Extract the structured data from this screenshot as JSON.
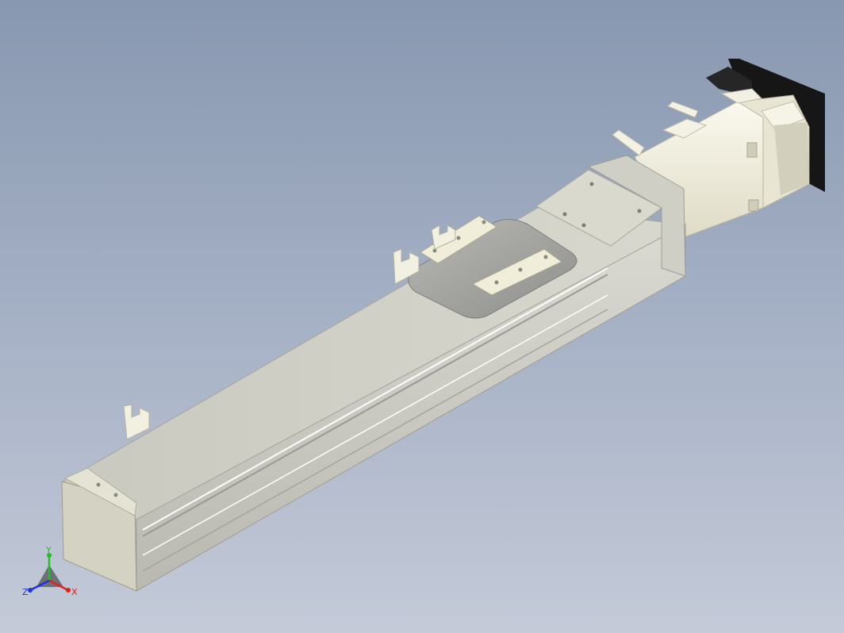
{
  "viewport": {
    "background_top": "#8898b0",
    "background_bottom": "#c4cad8"
  },
  "model": {
    "part": "linear-actuator-with-servo-motor",
    "body_color": "#d6d6cc",
    "accent_color": "#ece9d6",
    "motor_flange_color": "#1a1a1a"
  },
  "triad": {
    "x_label": "X",
    "y_label": "Y",
    "z_label": "Z",
    "x_color": "#e02020",
    "y_color": "#20c020",
    "z_color": "#2030e0"
  }
}
